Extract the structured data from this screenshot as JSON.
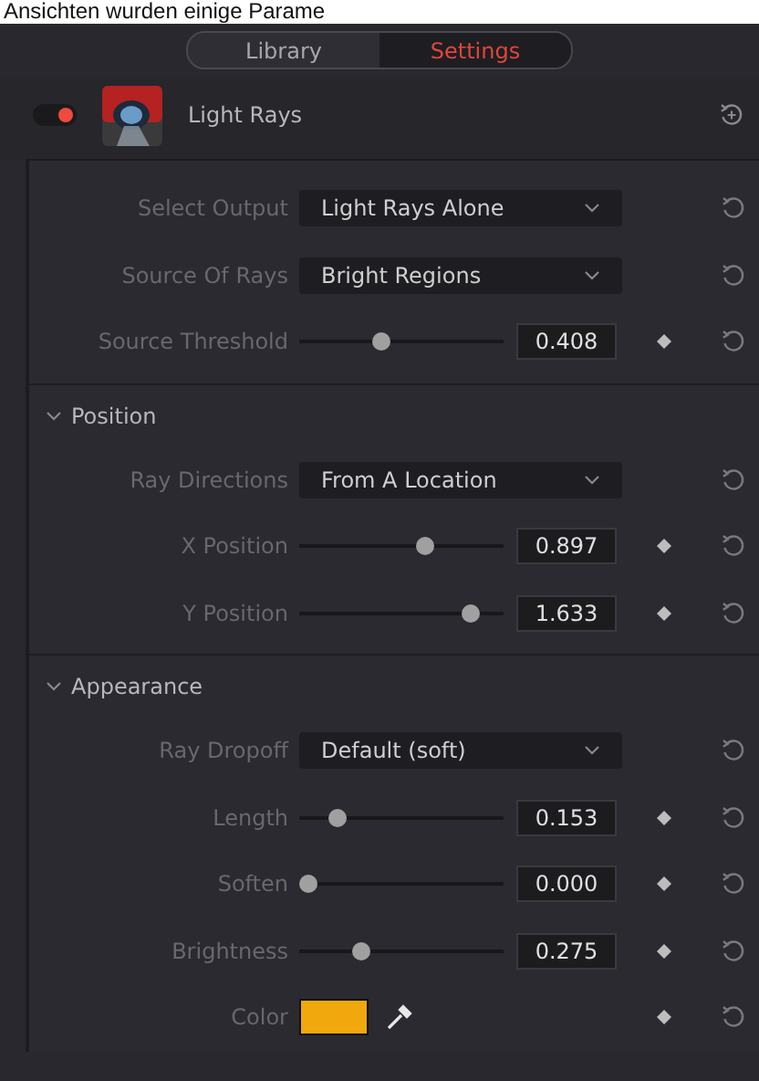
{
  "caption": "Ansichten wurden einige Parame",
  "tabs": [
    {
      "label": "Library",
      "selected": false
    },
    {
      "label": "Settings",
      "selected": true
    }
  ],
  "effect": {
    "name": "Light Rays",
    "enabled": true
  },
  "sections": [
    {
      "rows": [
        {
          "kind": "dropdown",
          "label": "Select Output",
          "value": "Light Rays Alone"
        },
        {
          "kind": "dropdown",
          "label": "Source Of Rays",
          "value": "Bright Regions"
        },
        {
          "kind": "slider",
          "label": "Source Threshold",
          "level": 0.39,
          "value": "0.408"
        }
      ]
    },
    {
      "title": "Position",
      "expanded": true,
      "rows": [
        {
          "kind": "dropdown",
          "label": "Ray Directions",
          "value": "From A Location"
        },
        {
          "kind": "slider",
          "label": "X Position",
          "level": 0.63,
          "value": "0.897"
        },
        {
          "kind": "slider",
          "label": "Y Position",
          "level": 0.87,
          "value": "1.633"
        }
      ]
    },
    {
      "title": "Appearance",
      "expanded": true,
      "rows": [
        {
          "kind": "dropdown",
          "label": "Ray Dropoff",
          "value": "Default (soft)"
        },
        {
          "kind": "slider",
          "label": "Length",
          "level": 0.16,
          "value": "0.153"
        },
        {
          "kind": "slider",
          "label": "Soften",
          "level": 0.0,
          "value": "0.000"
        },
        {
          "kind": "slider",
          "label": "Brightness",
          "level": 0.28,
          "value": "0.275"
        },
        {
          "kind": "color",
          "label": "Color",
          "color": "#f0a80c"
        }
      ]
    }
  ]
}
